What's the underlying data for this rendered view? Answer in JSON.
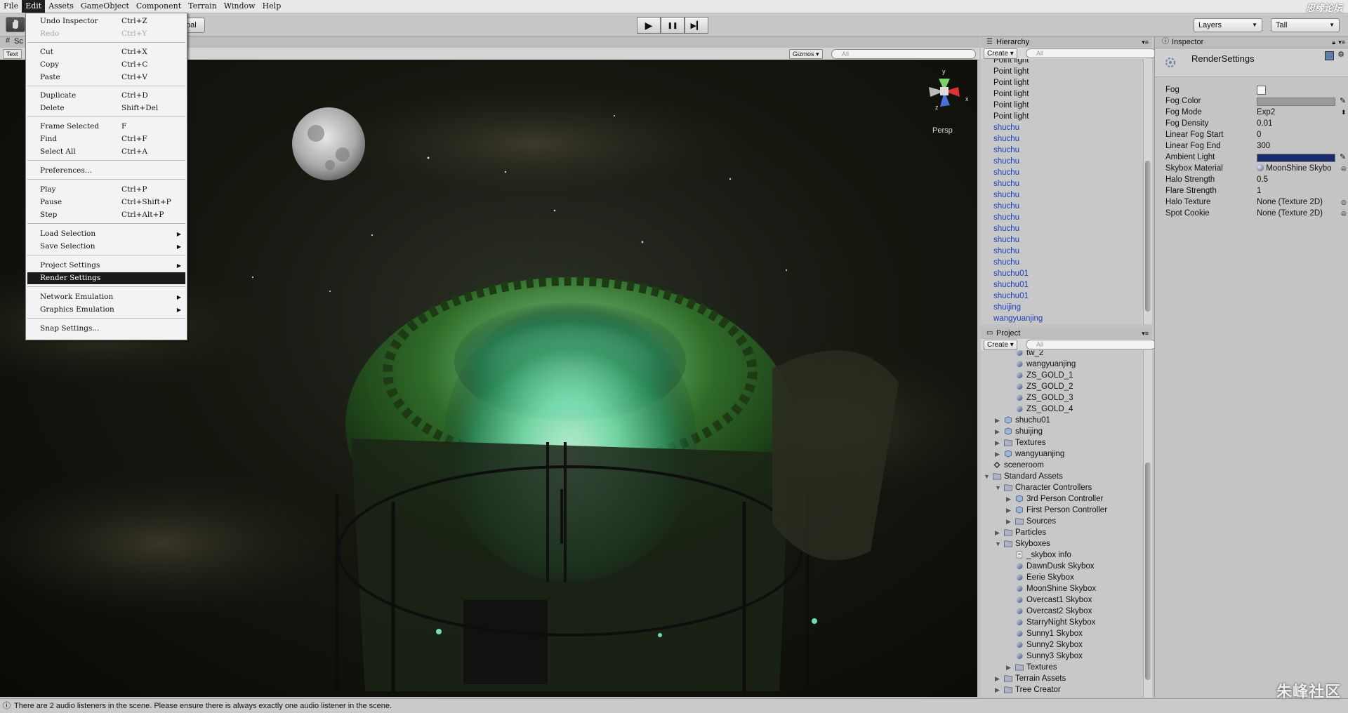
{
  "menu_bar": {
    "items": [
      "File",
      "Edit",
      "Assets",
      "GameObject",
      "Component",
      "Terrain",
      "Window",
      "Help"
    ],
    "active": "Edit",
    "brand": "思缘论坛"
  },
  "toolbar": {
    "global_label": "bal",
    "layers_label": "Layers",
    "layout_label": "Tall",
    "play": "▶",
    "pause": "❚❚",
    "step": "▶▎"
  },
  "scene": {
    "tab_label": "Sc",
    "render_mode": "Text",
    "gizmos_label": "Gizmos",
    "search_placeholder": "All",
    "view_label": "Persp",
    "axes": {
      "y": "y",
      "x": "x",
      "z": "z"
    }
  },
  "edit_menu": {
    "items": [
      {
        "label": "Undo Inspector",
        "shortcut": "Ctrl+Z"
      },
      {
        "label": "Redo",
        "shortcut": "Ctrl+Y"
      },
      {
        "label": "Cut",
        "shortcut": "Ctrl+X"
      },
      {
        "label": "Copy",
        "shortcut": "Ctrl+C"
      },
      {
        "label": "Paste",
        "shortcut": "Ctrl+V"
      },
      {
        "label": "Duplicate",
        "shortcut": "Ctrl+D"
      },
      {
        "label": "Delete",
        "shortcut": "Shift+Del"
      },
      {
        "label": "Frame Selected",
        "shortcut": "F"
      },
      {
        "label": "Find",
        "shortcut": "Ctrl+F"
      },
      {
        "label": "Select All",
        "shortcut": "Ctrl+A"
      },
      {
        "label": "Preferences...",
        "shortcut": ""
      },
      {
        "label": "Play",
        "shortcut": "Ctrl+P"
      },
      {
        "label": "Pause",
        "shortcut": "Ctrl+Shift+P"
      },
      {
        "label": "Step",
        "shortcut": "Ctrl+Alt+P"
      },
      {
        "label": "Load Selection",
        "shortcut": ""
      },
      {
        "label": "Save Selection",
        "shortcut": ""
      },
      {
        "label": "Project Settings",
        "shortcut": ""
      },
      {
        "label": "Render Settings",
        "shortcut": ""
      },
      {
        "label": "Network Emulation",
        "shortcut": ""
      },
      {
        "label": "Graphics Emulation",
        "shortcut": ""
      },
      {
        "label": "Snap Settings...",
        "shortcut": ""
      }
    ],
    "submenu_arrow": "▶"
  },
  "hierarchy": {
    "title": "Hierarchy",
    "create_label": "Create",
    "search_placeholder": "All",
    "items": [
      "Point light",
      "Point light",
      "Point light",
      "Point light",
      "Point light",
      "Point light",
      "shuchu",
      "shuchu",
      "shuchu",
      "shuchu",
      "shuchu",
      "shuchu",
      "shuchu",
      "shuchu",
      "shuchu",
      "shuchu",
      "shuchu",
      "shuchu",
      "shuchu",
      "shuchu01",
      "shuchu01",
      "shuchu01",
      "shuijing",
      "wangyuanjing"
    ]
  },
  "project": {
    "title": "Project",
    "create_label": "Create",
    "search_placeholder": "All",
    "items": [
      "tw_2",
      "wangyuanjing",
      "ZS_GOLD_1",
      "ZS_GOLD_2",
      "ZS_GOLD_3",
      "ZS_GOLD_4",
      "shuchu01",
      "shuijing",
      "Textures",
      "wangyuanjing",
      "sceneroom",
      "Standard Assets",
      "Character Controllers",
      "3rd Person Controller",
      "First Person Controller",
      "Sources",
      "Particles",
      "Skyboxes",
      "_skybox info",
      "DawnDusk Skybox",
      "Eerie Skybox",
      "MoonShine Skybox",
      "Overcast1 Skybox",
      "Overcast2 Skybox",
      "StarryNight Skybox",
      "Sunny1 Skybox",
      "Sunny2 Skybox",
      "Sunny3 Skybox",
      "Textures",
      "Terrain Assets",
      "Tree Creator"
    ]
  },
  "inspector": {
    "title": "Inspector",
    "object_name": "RenderSettings",
    "properties": [
      {
        "key": "Fog",
        "value": ""
      },
      {
        "key": "Fog Color",
        "value": ""
      },
      {
        "key": "Fog Mode",
        "value": "Exp2"
      },
      {
        "key": "Fog Density",
        "value": "0.01"
      },
      {
        "key": "Linear Fog Start",
        "value": "0"
      },
      {
        "key": "Linear Fog End",
        "value": "300"
      },
      {
        "key": "Ambient Light",
        "value": ""
      },
      {
        "key": "Skybox Material",
        "value": "MoonShine Skybo"
      },
      {
        "key": "Halo Strength",
        "value": "0.5"
      },
      {
        "key": "Flare Strength",
        "value": "1"
      },
      {
        "key": "Halo Texture",
        "value": "None (Texture 2D)"
      },
      {
        "key": "Spot Cookie",
        "value": "None (Texture 2D)"
      }
    ],
    "fog_color_hex": "#9a9a9a",
    "ambient_light_hex": "#1b2c6e"
  },
  "status": {
    "message": "There are 2 audio listeners in the scene. Please ensure there is always exactly one audio listener in the scene.",
    "watermark": "朱峰社区"
  }
}
